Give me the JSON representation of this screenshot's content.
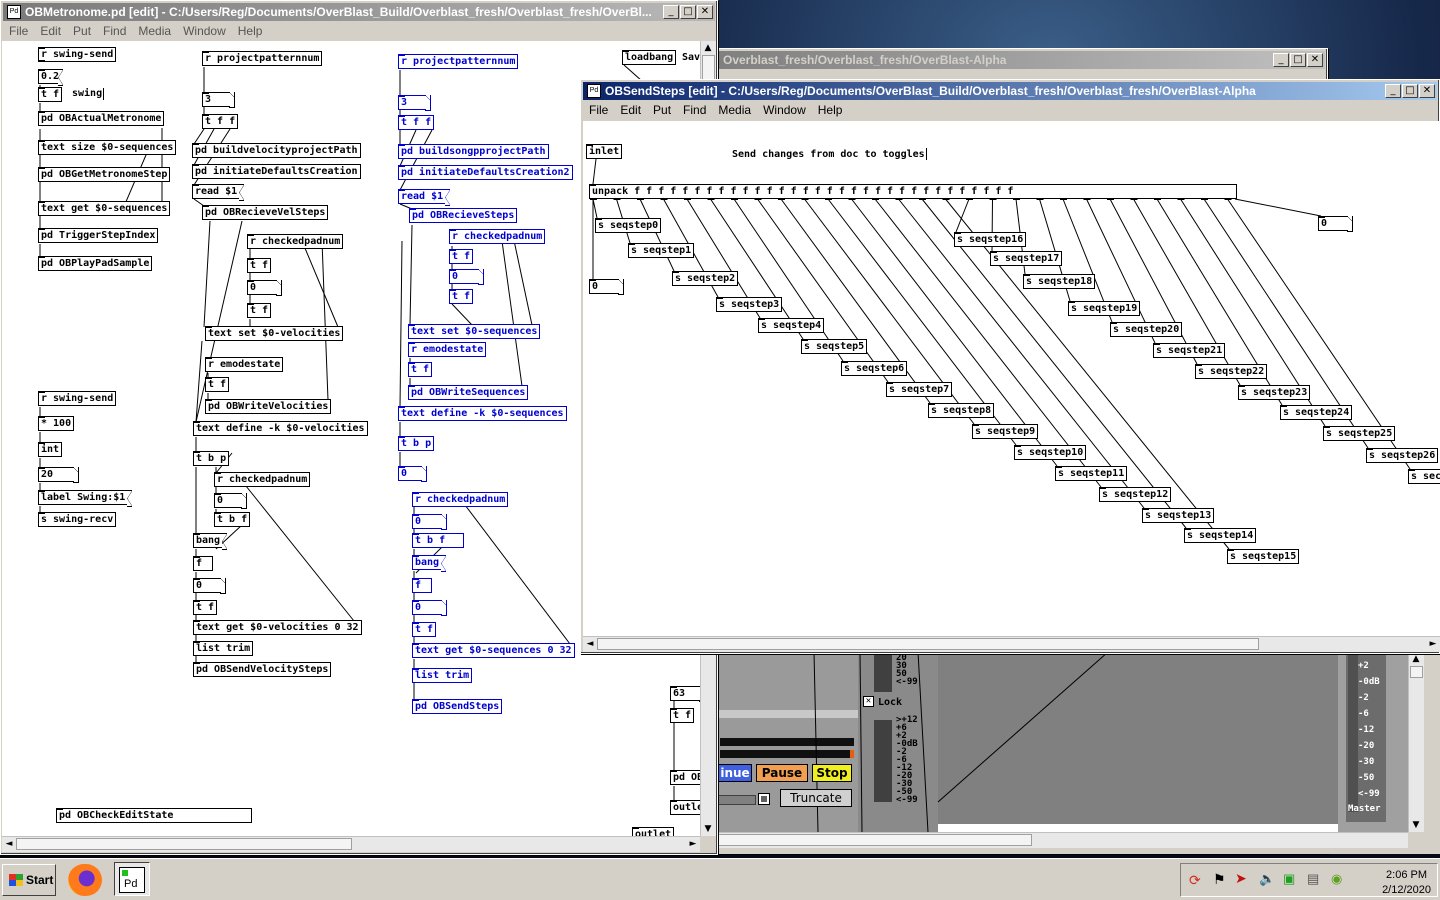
{
  "desktop": {
    "wallpaper": "space-earth"
  },
  "window_main": {
    "title": "OBMetronome.pd  [edit] - C:/Users/Reg/Documents/OverBlast_Build/Overblast_fresh/Overblast_fresh/OverBl...",
    "menu": [
      "File",
      "Edit",
      "Put",
      "Find",
      "Media",
      "Window",
      "Help"
    ],
    "col1": {
      "r_swing_send": "r swing-send",
      "msg_02": "0.2",
      "t_f": "t f",
      "swing_comment": "swing",
      "pd_actual": "pd OBActualMetronome",
      "text_size": "text size $0-sequences",
      "pd_getmetro": "pd OBGetMetronomeStep",
      "text_get": "text get $0-sequences",
      "pd_trigger": "pd TriggerStepIndex",
      "pd_playpad": "pd OBPlayPadSample",
      "r_swing_send2": "r swing-send",
      "mul100": "* 100",
      "int": "int",
      "num20": "20",
      "label_swing": "label Swing:$1",
      "s_swing_recv": "s swing-recv",
      "pd_checkedit": "pd OBCheckEditState"
    },
    "col2": {
      "r_projpat": "r projectpatternnum",
      "num3": "3",
      "tff": "t f f",
      "pd_buildvel": "pd buildvelocityprojectPath",
      "pd_initdef": "pd initiateDefaultsCreation",
      "read": "read $1",
      "pd_recvvel": "pd OBRecieveVelSteps",
      "r_checked": "r checkedpadnum",
      "t_f1": "t f",
      "n0": "0",
      "t_f2": "t f",
      "text_set_vel": "text set $0-velocities",
      "r_emode": "r emodestate",
      "t_f3": "t f",
      "pd_writevel": "pd OBWriteVelocities",
      "text_define_vel": "text define -k $0-velocities",
      "tbp": "t b p",
      "r_checked2": "r checkedpadnum",
      "n0b": "0",
      "tbf": "t b f",
      "bang": "bang",
      "f": "f",
      "n0c": "0",
      "t_f4": "t f",
      "text_get_vel": "text get $0-velocities 0 32",
      "list_trim": "list trim",
      "pd_sendvel": "pd OBSendVelocitySteps"
    },
    "col3": {
      "r_projpat": "r projectpatternnum",
      "num3": "3",
      "tff": "t f f",
      "pd_buildsong": "pd buildsongpprojectPath",
      "pd_initdef": "pd initiateDefaultsCreation2",
      "read": "read $1",
      "pd_recvsteps": "pd OBRecieveSteps",
      "r_checked": "r checkedpadnum",
      "t_f1": "t f",
      "n0": "0",
      "t_f2": "t f",
      "text_set_seq": "text set $0-sequences",
      "r_emode": "r emodestate",
      "t_f3": "t f",
      "pd_writeseq": "pd OBWriteSequences",
      "text_define_seq": "text define -k $0-sequences",
      "tbp": "t b p",
      "n0a": "0",
      "r_checked2": "r checkedpadnum",
      "n0b": "0",
      "tbf": "t b f",
      "bang": "bang",
      "f": "f",
      "n0c": "0",
      "t_f4": "t f",
      "text_get_seq": "text get $0-sequences 0 32",
      "list_trim": "list trim",
      "pd_sendsteps": "pd OBSendSteps"
    },
    "col4": {
      "loadbang": "loadbang",
      "save_fragment": "Sav",
      "num63": "63",
      "t_f": "t f",
      "pd_frag": "pd OB",
      "outlet_frag": "outle",
      "outlet_frag2": "outlet"
    }
  },
  "window_alpha": {
    "title": "Overblast_fresh/Overblast_fresh/OverBlast-Alpha",
    "mixer": {
      "scale_a": [
        "20",
        "30",
        "50",
        "<-99"
      ],
      "lock_label": "Lock",
      "scale_b": [
        ">+12",
        "+6",
        "+2",
        "-0dB",
        "-2",
        "-6",
        "-12",
        "-20",
        "-30",
        "-50",
        "<-99"
      ],
      "buttons": [
        "inue",
        "Pause",
        "Stop",
        "Truncate"
      ],
      "master_scale": [
        "+2",
        "-0dB",
        "-2",
        "-6",
        "-12",
        "-20",
        "-30",
        "-50",
        "<-99"
      ],
      "master_label": "Master"
    }
  },
  "window_sendsteps": {
    "title": "OBSendSteps  [edit] - C:/Users/Reg/Documents/OverBlast_Build/Overblast_fresh/Overblast_fresh/OverBlast-Alpha",
    "menu": [
      "File",
      "Edit",
      "Put",
      "Find",
      "Media",
      "Window",
      "Help"
    ],
    "inlet": "inlet",
    "comment": "Send changes from doc to toggles",
    "unpack": "unpack f f f f f f f f f f f f f f f f f f f f f f f f f f f f f f f f",
    "num_right": "0",
    "num_left": "0",
    "steps": [
      "s seqstep0",
      "s seqstep1",
      "s seqstep2",
      "s seqstep3",
      "s seqstep4",
      "s seqstep5",
      "s seqstep6",
      "s seqstep7",
      "s seqstep8",
      "s seqstep9",
      "s seqstep10",
      "s seqstep11",
      "s seqstep12",
      "s seqstep13",
      "s seqstep14",
      "s seqstep15",
      "s seqstep16",
      "s seqstep17",
      "s seqstep18",
      "s seqstep19",
      "s seqstep20",
      "s seqstep21",
      "s seqstep22",
      "s seqstep23",
      "s seqstep24",
      "s seqstep25",
      "s seqstep26",
      "s sec"
    ]
  },
  "taskbar": {
    "start": "Start",
    "apps": [
      "firefox-icon",
      "pd-icon"
    ],
    "pd_label": "Pd",
    "time": "2:06 PM",
    "date": "2/12/2020"
  }
}
